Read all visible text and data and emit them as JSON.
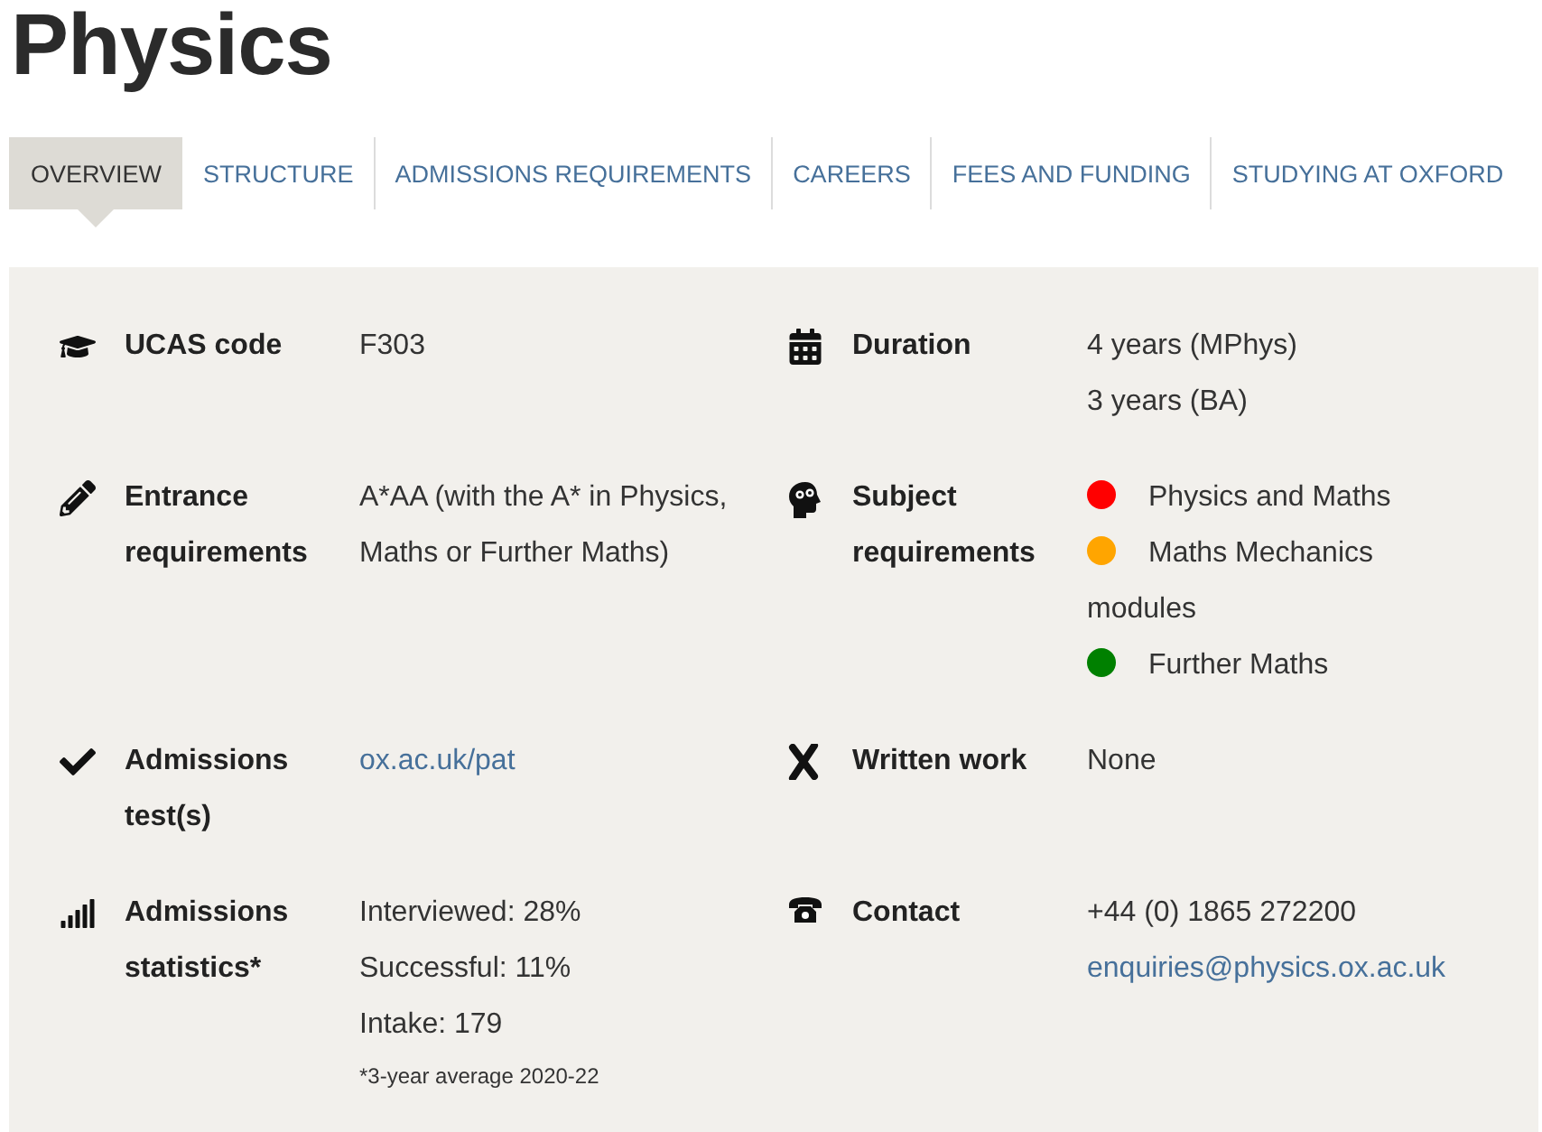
{
  "title": "Physics",
  "tabs": [
    {
      "label": "OVERVIEW",
      "selected": true
    },
    {
      "label": "STRUCTURE",
      "selected": false
    },
    {
      "label": "ADMISSIONS REQUIREMENTS",
      "selected": false
    },
    {
      "label": "CAREERS",
      "selected": false
    },
    {
      "label": "FEES AND FUNDING",
      "selected": false
    },
    {
      "label": "STUDYING AT OXFORD",
      "selected": false
    }
  ],
  "facts": [
    {
      "label": "UCAS code",
      "lines": [
        {
          "kind": "text",
          "text": "F303"
        }
      ]
    },
    {
      "label": "Duration",
      "lines": [
        {
          "kind": "text",
          "text": "4 years (MPhys)"
        },
        {
          "kind": "text",
          "text": "3 years (BA)"
        }
      ]
    },
    {
      "label": "Entrance requirements",
      "lines": [
        {
          "kind": "text",
          "text": "A*AA (with the A* in Physics, Maths or Further Maths)"
        }
      ]
    },
    {
      "label": "Subject requirements",
      "lines": [
        {
          "kind": "dot",
          "text": "Physics and Maths",
          "color": "#ff0000"
        },
        {
          "kind": "dot",
          "text": "Maths Mechanics modules",
          "color": "#ffa500"
        },
        {
          "kind": "dot",
          "text": "Further Maths",
          "color": "#008000"
        }
      ]
    },
    {
      "label": "Admissions test(s)",
      "lines": [
        {
          "kind": "link",
          "text": "ox.ac.uk/pat"
        }
      ]
    },
    {
      "label": "Written work",
      "lines": [
        {
          "kind": "text",
          "text": "None"
        }
      ]
    },
    {
      "label": "Admissions statistics*",
      "lines": [
        {
          "kind": "text",
          "text": "Interviewed: 28%"
        },
        {
          "kind": "text",
          "text": "Successful: 11%"
        },
        {
          "kind": "text",
          "text": "Intake: 179"
        },
        {
          "kind": "note",
          "text": "*3-year average 2020-22"
        }
      ]
    },
    {
      "label": "Contact",
      "lines": [
        {
          "kind": "text",
          "text": "+44 (0) 1865 272200"
        },
        {
          "kind": "link",
          "text": "enquiries@physics.ox.ac.uk"
        }
      ]
    }
  ]
}
